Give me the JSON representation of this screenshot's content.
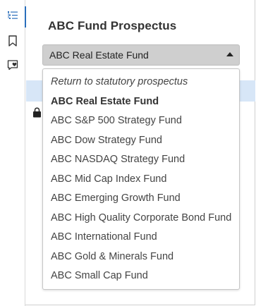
{
  "sidebar": {
    "buttons": [
      {
        "name": "table-of-contents",
        "icon": "list-tree-icon",
        "active": true
      },
      {
        "name": "bookmarks",
        "icon": "bookmark-icon",
        "active": false
      },
      {
        "name": "saved-items",
        "icon": "heart-note-icon",
        "active": false
      }
    ]
  },
  "header": {
    "title": "ABC Fund Prospectus"
  },
  "fund_select": {
    "value": "ABC Real Estate Fund",
    "options": [
      "Return to statutory prospectus",
      "ABC Real Estate Fund",
      "ABC S&P 500 Strategy Fund",
      "ABC Dow Strategy Fund",
      "ABC NASDAQ Strategy Fund",
      "ABC Mid Cap Index Fund",
      "ABC Emerging Growth Fund",
      "ABC High Quality Corporate Bond Fund",
      "ABC International Fund",
      "ABC Gold & Minerals Fund",
      "ABC Small Cap Fund"
    ]
  },
  "colors": {
    "accent": "#2a6ebb",
    "highlight_band": "#d7e6f7",
    "select_bg": "#cfcfcf"
  }
}
